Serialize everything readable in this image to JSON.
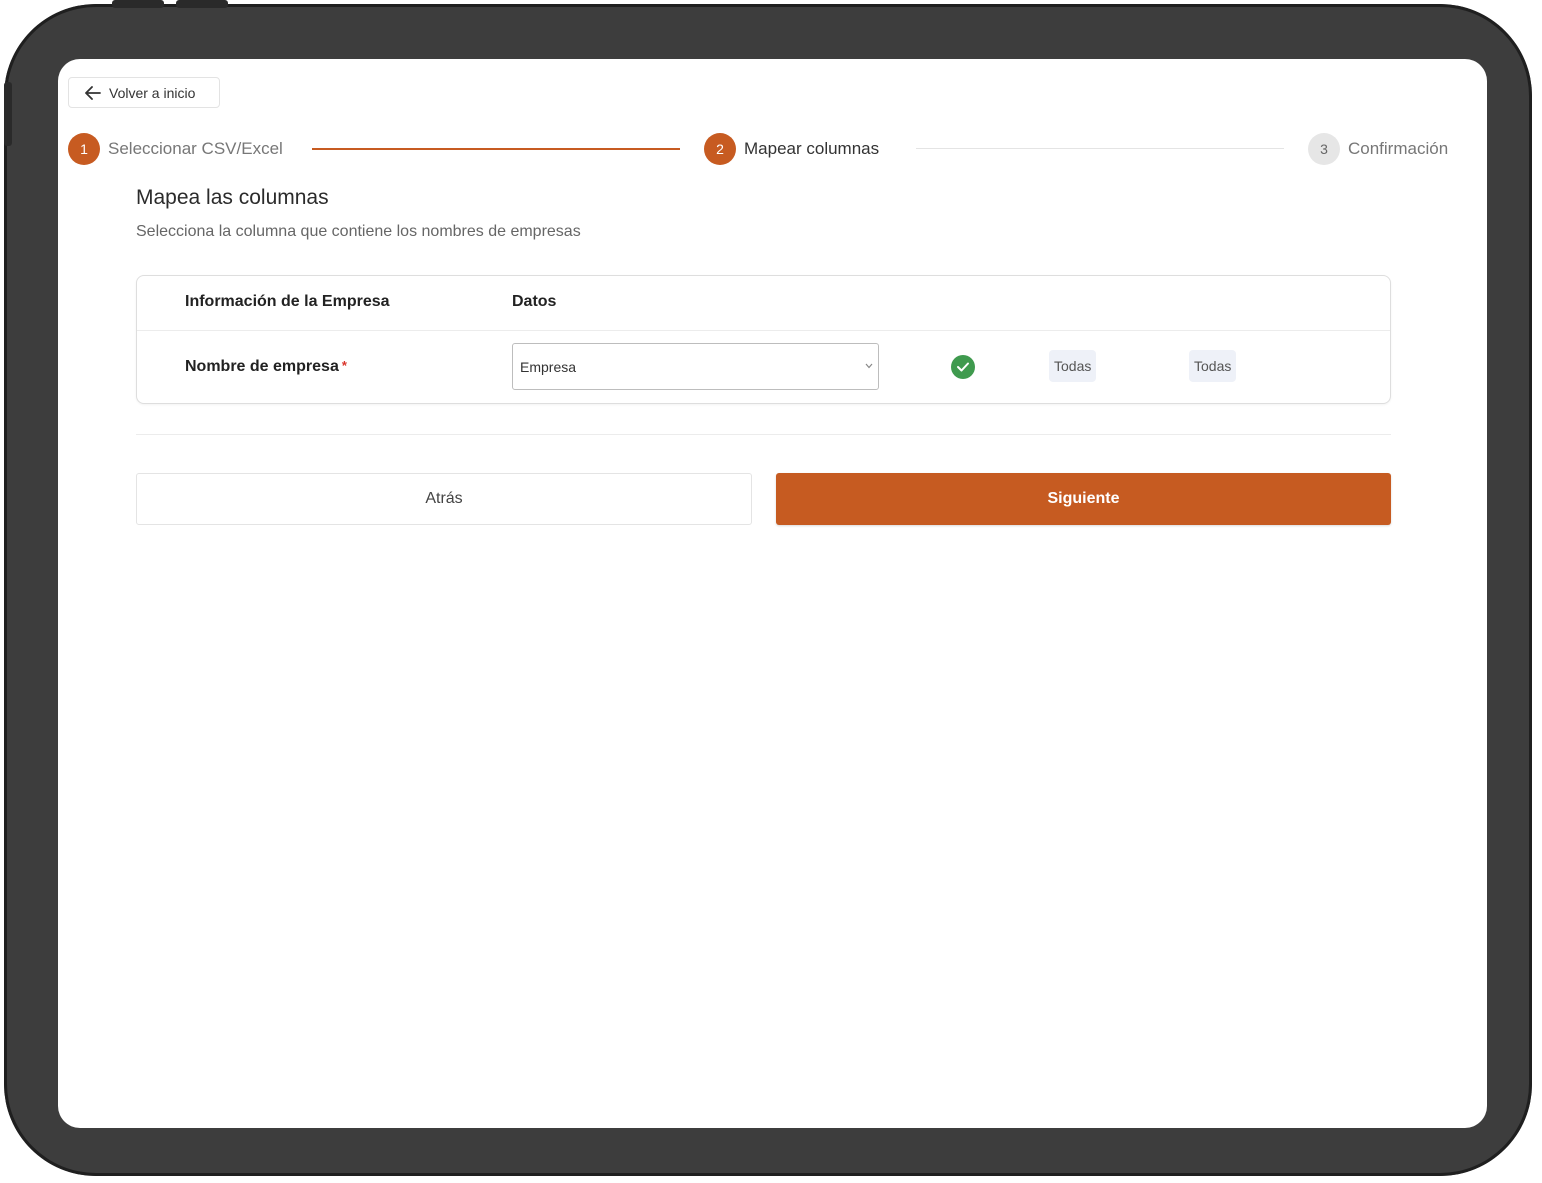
{
  "nav": {
    "back_label": "Volver a inicio"
  },
  "stepper": {
    "steps": [
      {
        "number": "1",
        "label": "Seleccionar CSV/Excel"
      },
      {
        "number": "2",
        "label": "Mapear columnas"
      },
      {
        "number": "3",
        "label": "Confirmación"
      }
    ]
  },
  "main": {
    "title": "Mapea las columnas",
    "subtitle": "Selecciona la columna que contiene los nombres de empresas"
  },
  "mapping": {
    "headers": [
      "Información de la Empresa",
      "Datos"
    ],
    "rows": [
      {
        "label": "Nombre de empresa",
        "required_mark": "*",
        "selected": "Empresa",
        "status_icon": "check-icon",
        "tags": [
          "Todas",
          "Todas"
        ]
      }
    ]
  },
  "actions": {
    "back_label": "Atrás",
    "next_label": "Siguiente"
  },
  "colors": {
    "accent": "#c65b21",
    "success": "#3f9a4e",
    "device_frame": "#3d3d3d"
  }
}
